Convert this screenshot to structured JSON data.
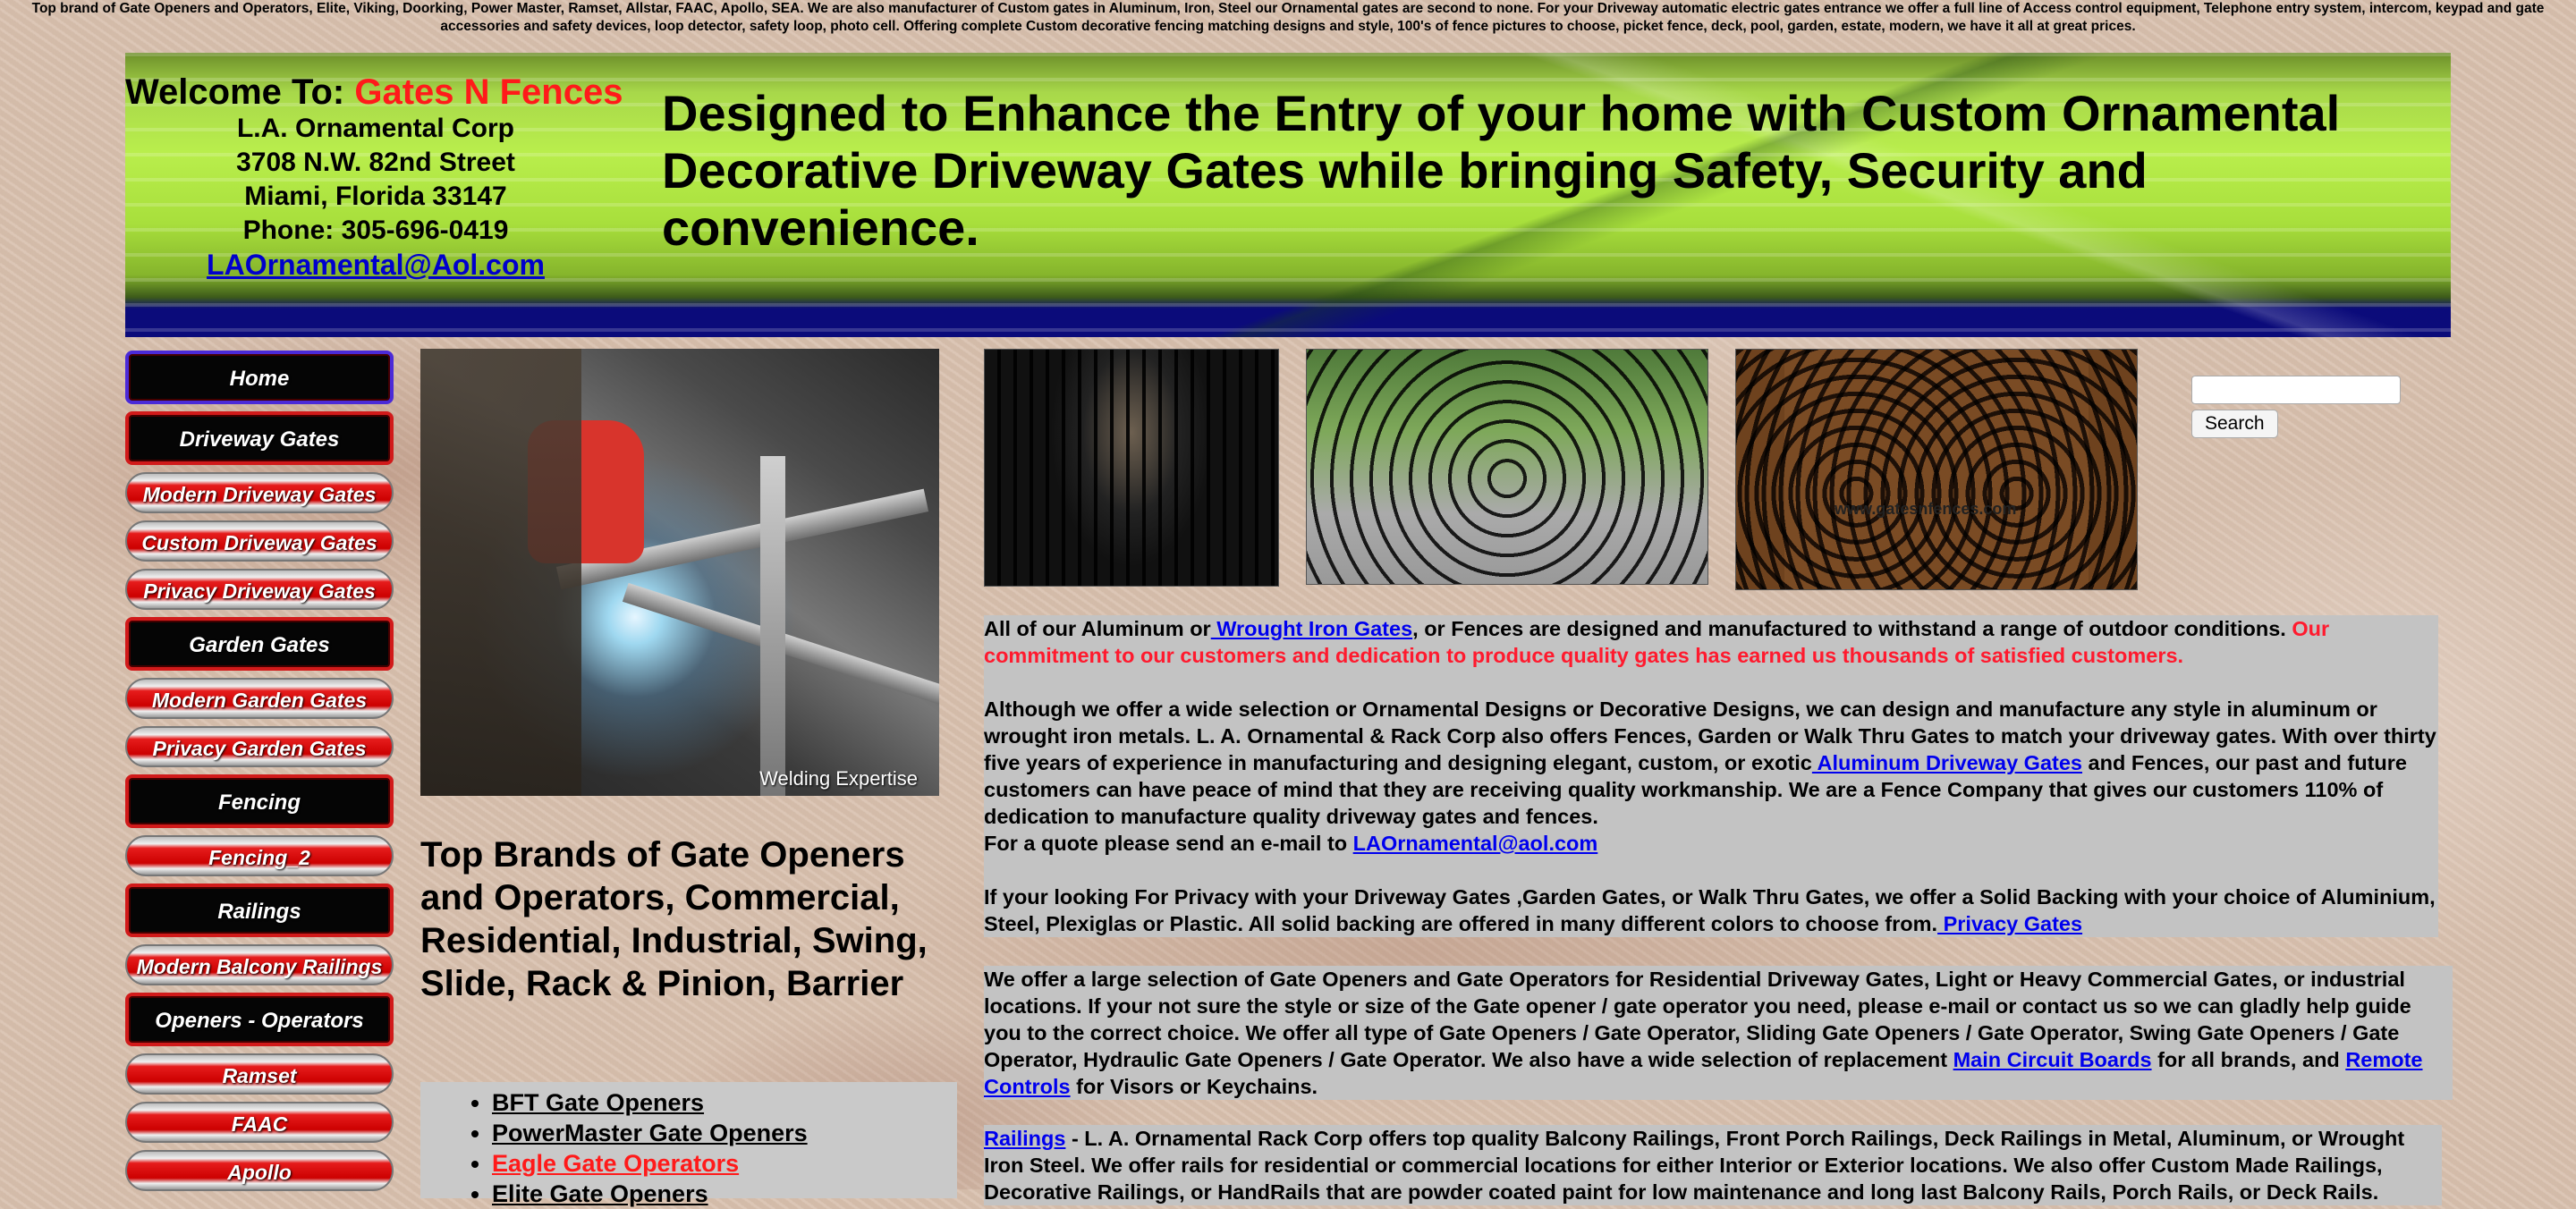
{
  "top_text": "Top brand of Gate Openers and Operators, Elite, Viking, Doorking, Power Master, Ramset, Allstar, FAAC, Apollo, SEA. We are also manufacturer of Custom gates in Aluminum, Iron, Steel our Ornamental gates are second to none. For your Driveway automatic electric gates entrance we offer a full line of Access control equipment, Telephone entry system, intercom, keypad and gate accessories and safety devices, loop detector, safety loop, photo cell. Offering complete Custom decorative fencing matching designs and style, 100's of fence pictures to choose, picket fence, deck, pool, garden, estate, modern, we have it all at great prices.",
  "header": {
    "welcome_prefix": "Welcome To: ",
    "brand": "Gates N Fences",
    "company": "L.A. Ornamental Corp",
    "street": "3708 N.W. 82nd Street",
    "city": "Miami, Florida 33147",
    "phone": "Phone: 305-696-0419",
    "email": "LAOrnamental@Aol.com",
    "headline": "Designed to Enhance the Entry of your home with Custom Ornamental Decorative Driveway Gates while bringing Safety, Security and convenience."
  },
  "nav": [
    {
      "label": "Home",
      "style": "black"
    },
    {
      "label": "Driveway Gates",
      "style": "black"
    },
    {
      "label": "Modern Driveway Gates",
      "style": "red"
    },
    {
      "label": "Custom Driveway Gates",
      "style": "red"
    },
    {
      "label": "Privacy Driveway Gates",
      "style": "red"
    },
    {
      "label": "Garden Gates",
      "style": "black"
    },
    {
      "label": "Modern Garden Gates",
      "style": "red"
    },
    {
      "label": "Privacy Garden Gates",
      "style": "red"
    },
    {
      "label": "Fencing",
      "style": "black"
    },
    {
      "label": "Fencing_2",
      "style": "red"
    },
    {
      "label": "Railings",
      "style": "black"
    },
    {
      "label": "Modern Balcony Railings",
      "style": "red"
    },
    {
      "label": "Openers - Operators",
      "style": "black"
    },
    {
      "label": "Ramset",
      "style": "red"
    },
    {
      "label": "FAAC",
      "style": "red"
    },
    {
      "label": "Apollo",
      "style": "red"
    }
  ],
  "welding_caption": "Welding Expertise",
  "gate_watermark": "www.gatesnfences.com",
  "brands_heading": "Top Brands of Gate Openers and Operators, Commercial, Residential, Industrial, Swing, Slide, Rack & Pinion, Barrier",
  "brand_links": [
    {
      "label": "BFT Gate Openers",
      "color": "black"
    },
    {
      "label": "PowerMaster Gate Openers",
      "color": "black"
    },
    {
      "label": "Eagle Gate Operators",
      "color": "red"
    },
    {
      "label": "Elite Gate Openers",
      "color": "black"
    }
  ],
  "search": {
    "button": "Search",
    "value": ""
  },
  "content": {
    "p1_a": "All of our Aluminum or",
    "p1_link": " Wrought Iron Gates",
    "p1_b": ", or Fences are designed and manufactured to withstand a range of outdoor conditions. ",
    "p1_red": "Our commitment to our customers and dedication to produce quality gates has earned us thousands of satisfied customers.",
    "p2_a": "Although we offer a wide selection or Ornamental Designs or Decorative Designs, we can design and manufacture any style in aluminum or wrought iron metals. L. A. Ornamental & Rack Corp also offers Fences, Garden or Walk Thru Gates to match your driveway  gates. With over thirty five years of experience in manufacturing and designing elegant, custom, or exotic",
    "p2_link": " Aluminum Driveway Gates",
    "p2_b": " and Fences, our past and future customers can have peace of mind that they are receiving quality workmanship.  We are a Fence Company that gives our customers 110% of dedication to manufacture quality driveway gates and fences.",
    "p2_quote": "For a quote please send an e-mail to ",
    "p2_email": "LAOrnamental@aol.com",
    "p3_a": "If your looking For Privacy with your Driveway Gates ,Garden Gates, or Walk Thru Gates, we offer a Solid Backing with your choice of Aluminium, Steel, Plexiglas or Plastic.  All solid backing are offered in many different colors to choose from.",
    "p3_link": " Privacy Gates",
    "p4_a": "We offer a large selection of  Gate Openers and Gate Operators for Residential Driveway Gates, Light or Heavy Commercial Gates, or industrial locations. If your not sure the style or size of the Gate opener / gate operator  you need, please e-mail or contact us so we can gladly help guide you to the correct choice. We offer all type of Gate Openers / Gate Operator, Sliding Gate Openers / Gate Operator, Swing Gate Openers / Gate Operator, Hydraulic Gate Openers / Gate Operator. We also have a wide selection of replacement ",
    "p4_link1": "Main Circuit Boards",
    "p4_b": " for all brands, and ",
    "p4_link2": "Remote Controls",
    "p4_c": "  for Visors or Keychains.",
    "p5_link": "Railings",
    "p5_a": " - L. A. Ornamental Rack Corp offers top quality Balcony Railings, Front Porch Railings, Deck Railings in Metal, Aluminum, or Wrought Iron Steel.  We offer rails for residential or commercial locations for either Interior or Exterior locations. We also offer Custom Made Railings, Decorative Railings, or HandRails that are powder coated paint for low maintenance and long last Balcony Rails, Porch Rails, or Deck Rails."
  },
  "colors": {
    "brand_red": "#ff1a1a",
    "link_blue": "#0000ee",
    "nav_black_border": "#d11a1a",
    "nav_home_border": "#4a2ad8",
    "content_box": "#c3c3c3",
    "banner_green": "#b9ee4c",
    "banner_navy": "#0b0b7a"
  }
}
